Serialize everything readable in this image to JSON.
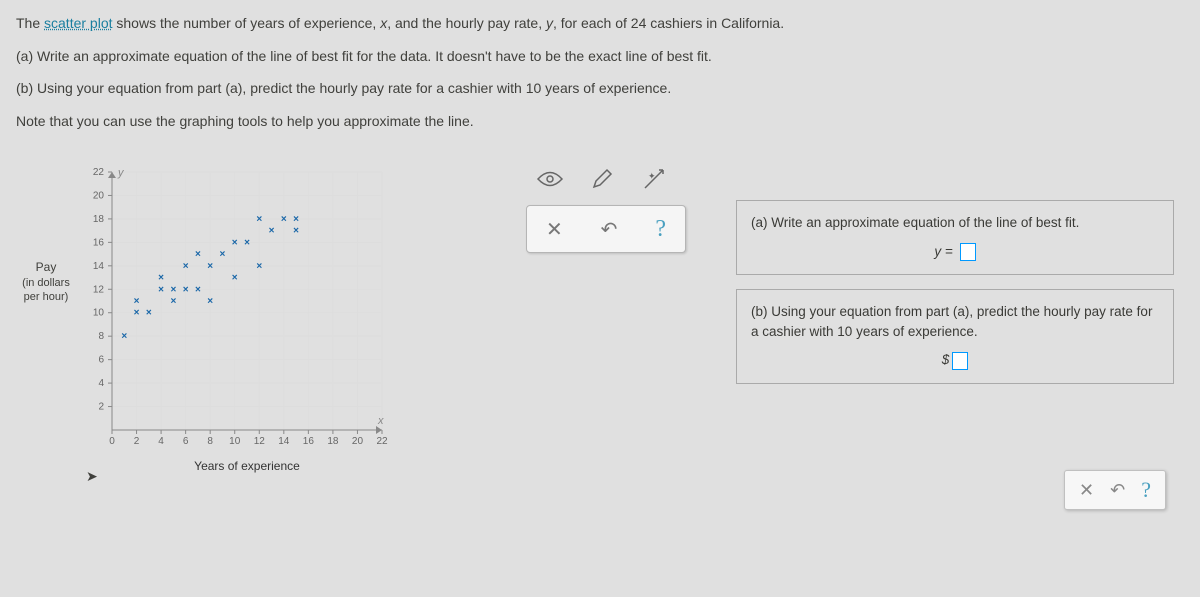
{
  "problem": {
    "intro_pre": "The ",
    "intro_link": "scatter plot",
    "intro_post": " shows the number of years of experience, ",
    "x_var": "x",
    "intro_post2": ", and the hourly pay rate, ",
    "y_var": "y",
    "intro_post3": ", for each of ",
    "n": "24",
    "intro_post4": " cashiers in California.",
    "part_a": "(a) Write an approximate equation of the line of best fit for the data. It doesn't have to be the exact line of best fit.",
    "part_b_pre": "(b) Using your equation from part (a), predict the hourly pay rate for a cashier with ",
    "part_b_years": "10",
    "part_b_post": " years of experience.",
    "note": "Note that you can use the graphing tools to help you approximate the line."
  },
  "chart_data": {
    "type": "scatter",
    "title": "",
    "xlabel": "Years of experience",
    "ylabel_line1": "Pay",
    "ylabel_line2": "in dollars",
    "ylabel_line3": "per hour",
    "xlim": [
      0,
      22
    ],
    "ylim": [
      0,
      22
    ],
    "x_ticks": [
      0,
      2,
      4,
      6,
      8,
      10,
      12,
      14,
      16,
      18,
      20,
      22
    ],
    "y_ticks": [
      2,
      4,
      6,
      8,
      10,
      12,
      14,
      16,
      18,
      20,
      22
    ],
    "x_var": "x",
    "y_var": "y",
    "points": [
      {
        "x": 1,
        "y": 8
      },
      {
        "x": 2,
        "y": 11
      },
      {
        "x": 2,
        "y": 10
      },
      {
        "x": 3,
        "y": 10
      },
      {
        "x": 4,
        "y": 13
      },
      {
        "x": 4,
        "y": 12
      },
      {
        "x": 5,
        "y": 12
      },
      {
        "x": 5,
        "y": 11
      },
      {
        "x": 6,
        "y": 12
      },
      {
        "x": 6,
        "y": 14
      },
      {
        "x": 7,
        "y": 12
      },
      {
        "x": 7,
        "y": 15
      },
      {
        "x": 8,
        "y": 11
      },
      {
        "x": 8,
        "y": 14
      },
      {
        "x": 9,
        "y": 15
      },
      {
        "x": 10,
        "y": 13
      },
      {
        "x": 10,
        "y": 16
      },
      {
        "x": 11,
        "y": 16
      },
      {
        "x": 12,
        "y": 14
      },
      {
        "x": 12,
        "y": 18
      },
      {
        "x": 13,
        "y": 17
      },
      {
        "x": 14,
        "y": 18
      },
      {
        "x": 15,
        "y": 17
      },
      {
        "x": 15,
        "y": 18
      }
    ]
  },
  "tools": {
    "eye": "eye-tool",
    "pencil": "pencil-tool",
    "line": "line-tool"
  },
  "controls": {
    "clear": "✕",
    "reset": "↶",
    "help": "?"
  },
  "answers": {
    "a_prompt": "(a) Write an approximate equation of the line of best fit.",
    "a_eq_lhs": "y = ",
    "b_prompt_pre": "(b) Using your equation from part (a), predict the hourly pay rate for a cashier with ",
    "b_years": "10",
    "b_prompt_post": " years of experience.",
    "b_prefix": "$"
  }
}
